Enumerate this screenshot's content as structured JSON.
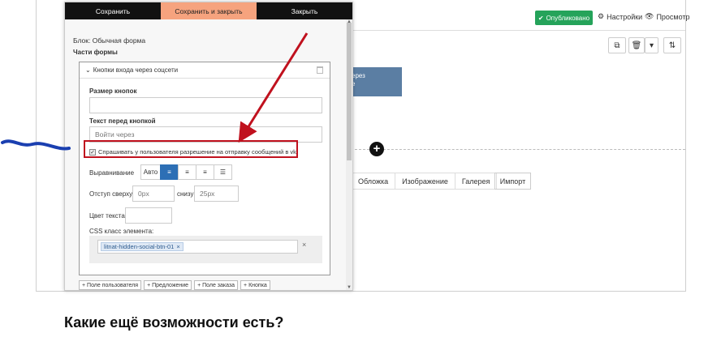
{
  "editor": {
    "publish_label": "Опубликовано",
    "settings_label": "Настройки",
    "preview_label": "Просмотр",
    "blue_block_lines": [
      "ерез",
      "е"
    ],
    "categories": [
      "Обложка",
      "Изображение",
      "Галерея"
    ],
    "import_label": "Импорт",
    "plus_symbol": "+"
  },
  "panel": {
    "actions": {
      "save": "Сохранить",
      "save_close": "Сохранить и закрыть",
      "close": "Закрыть"
    },
    "block_title": "Блок: Обычная форма",
    "form_parts_label": "Части формы",
    "section_title": "Кнопки входа через соцсети",
    "button_size_label": "Размер кнопок",
    "button_size_value": "",
    "text_before_label": "Текст перед кнопкой",
    "text_before_value": "Войти через",
    "checkbox_label": "Спрашивать у пользователя разрешение на отправку сообщений в vk",
    "align_label": "Выравнивание",
    "align_auto": "Авто",
    "margin_top_label": "Отступ сверху:",
    "margin_top_placeholder": "0px",
    "margin_bottom_label": "снизу:",
    "margin_bottom_placeholder": "25px",
    "text_color_label": "Цвет текста:",
    "css_class_label": "CSS класс элемента:",
    "css_tag": "litnat-hidden-social-btn-01",
    "tag_remove": "×",
    "clear_symbol": "×",
    "add_buttons": [
      "+ Поле пользователя",
      "+ Предложение",
      "+ Поле заказа",
      "+ Кнопка"
    ]
  },
  "article": {
    "heading": "Какие ещё возможности есть?"
  },
  "colors": {
    "accent": "#f6a37e",
    "publish": "#25a35a",
    "highlight": "#c0111e",
    "scribble": "#1a3fb0",
    "align_active": "#2d6fb5"
  }
}
